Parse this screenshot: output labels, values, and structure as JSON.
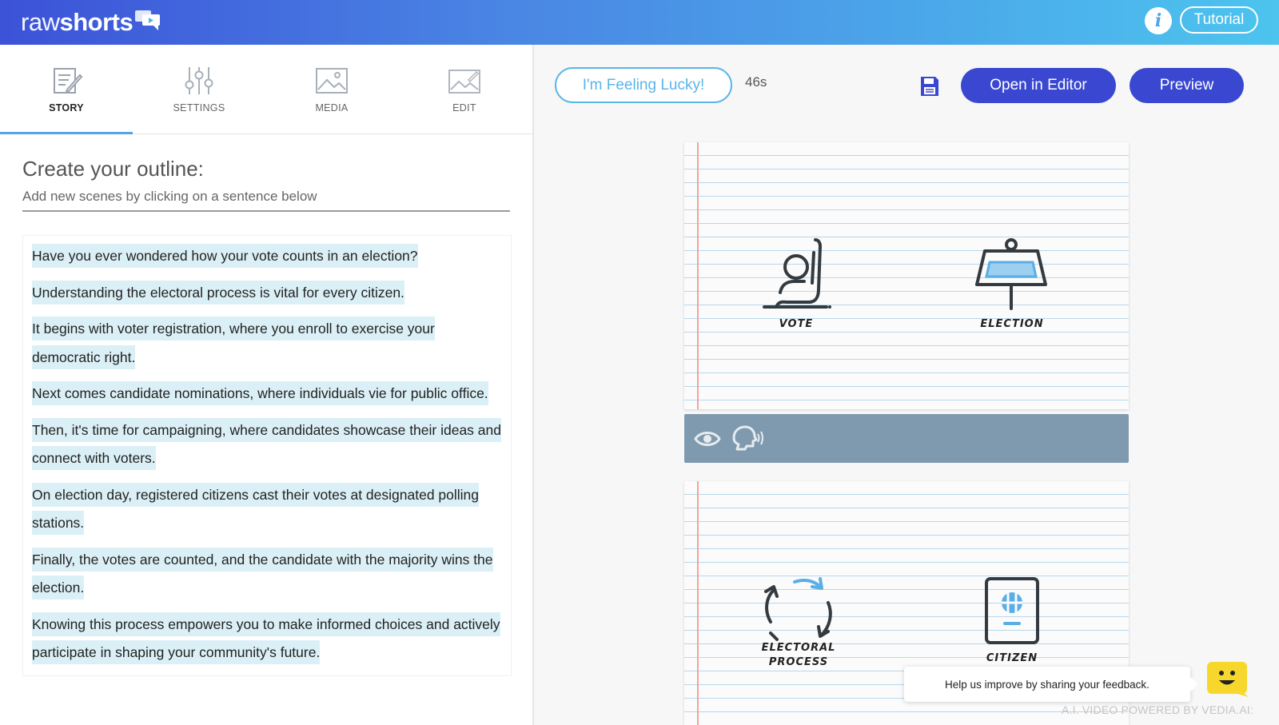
{
  "header": {
    "logo_raw": "raw",
    "logo_shorts": "shorts",
    "info_glyph": "i",
    "tutorial_label": "Tutorial"
  },
  "tabs": [
    {
      "label": "STORY",
      "icon": "story-icon",
      "active": true
    },
    {
      "label": "SETTINGS",
      "icon": "sliders-icon",
      "active": false
    },
    {
      "label": "MEDIA",
      "icon": "image-icon",
      "active": false
    },
    {
      "label": "EDIT",
      "icon": "edit-image-icon",
      "active": false
    }
  ],
  "outline": {
    "title": "Create your outline:",
    "subtitle": "Add new scenes by clicking on a sentence below",
    "sentences": [
      "Have you ever wondered how your vote counts in an election?",
      "Understanding the electoral process is vital for every citizen.",
      "It begins with voter registration, where you enroll to exercise your democratic right.",
      "Next comes candidate nominations, where individuals vie for public office.",
      "Then, it's time for campaigning, where candidates showcase their ideas and connect with voters.",
      "On election day, registered citizens cast their votes at designated polling stations.",
      "Finally, the votes are counted, and the candidate with the majority wins the election.",
      "Knowing this process empowers you to make informed choices and actively participate in shaping your community's future."
    ]
  },
  "toolbar": {
    "lucky_label": "I'm Feeling Lucky!",
    "duration": "46s",
    "open_editor_label": "Open in Editor",
    "preview_label": "Preview"
  },
  "scenes": [
    {
      "keywords": [
        "VOTE",
        "ELECTION"
      ]
    },
    {
      "keywords": [
        "ELECTORAL PROCESS",
        "CITIZEN"
      ]
    }
  ],
  "feedback": {
    "text": "Help us improve by sharing your feedback.",
    "powered_by": "A.I. VIDEO POWERED BY VEDIA.AI:"
  },
  "colors": {
    "accent_blue": "#3a48d1",
    "light_blue": "#5ab5ea",
    "highlight": "#dbf0f6",
    "scene_bar": "#7f9aae",
    "bot_yellow": "#f7d72c"
  }
}
